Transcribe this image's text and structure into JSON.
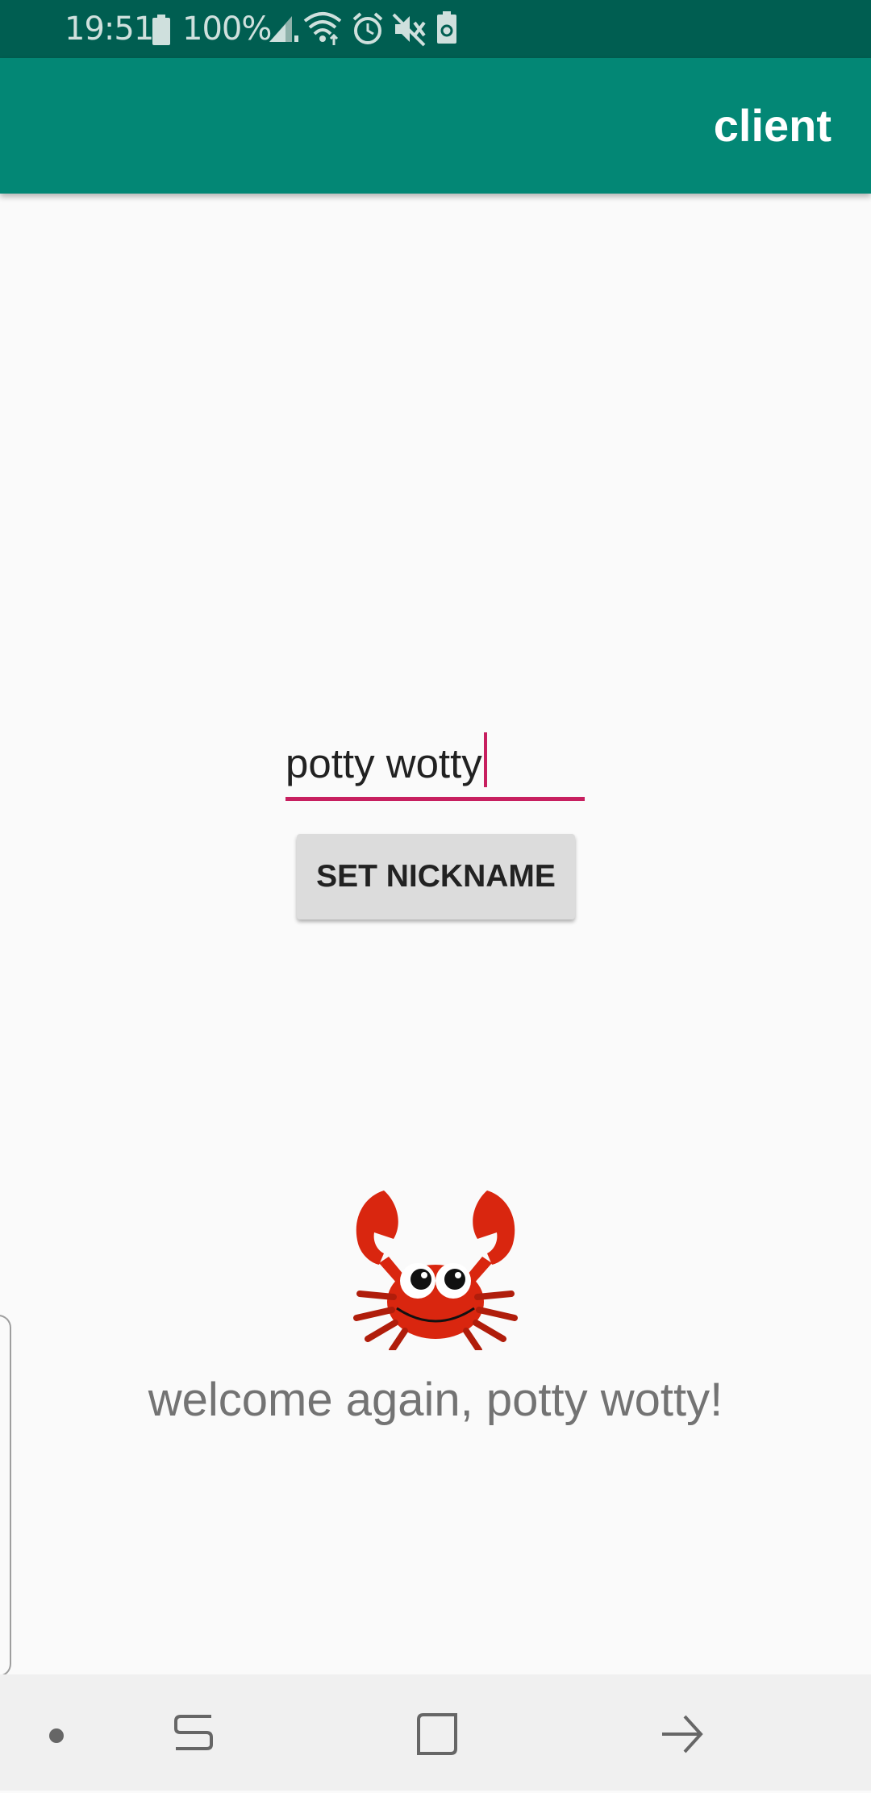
{
  "status_bar": {
    "time": "19:51",
    "battery_percent": "100%",
    "icons": [
      "battery-icon",
      "signal-icon",
      "wifi-icon",
      "alarm-icon",
      "mute-icon",
      "battery-saver-icon"
    ]
  },
  "app_bar": {
    "title": "client"
  },
  "nickname_input": {
    "value": "potty wotty"
  },
  "set_nickname_button": {
    "label": "SET NICKNAME"
  },
  "welcome": {
    "icon": "crab-icon",
    "message": "welcome again, potty wotty!"
  },
  "nav_bar": {
    "items": [
      "dot-icon",
      "recent-apps-icon",
      "home-icon",
      "back-icon"
    ]
  },
  "colors": {
    "status_bar": "#005e51",
    "app_bar": "#038775",
    "accent": "#c71f5f",
    "button": "#dcdcdc",
    "background": "#fafafa",
    "welcome_text": "#737373",
    "crab": "#d9260f"
  }
}
